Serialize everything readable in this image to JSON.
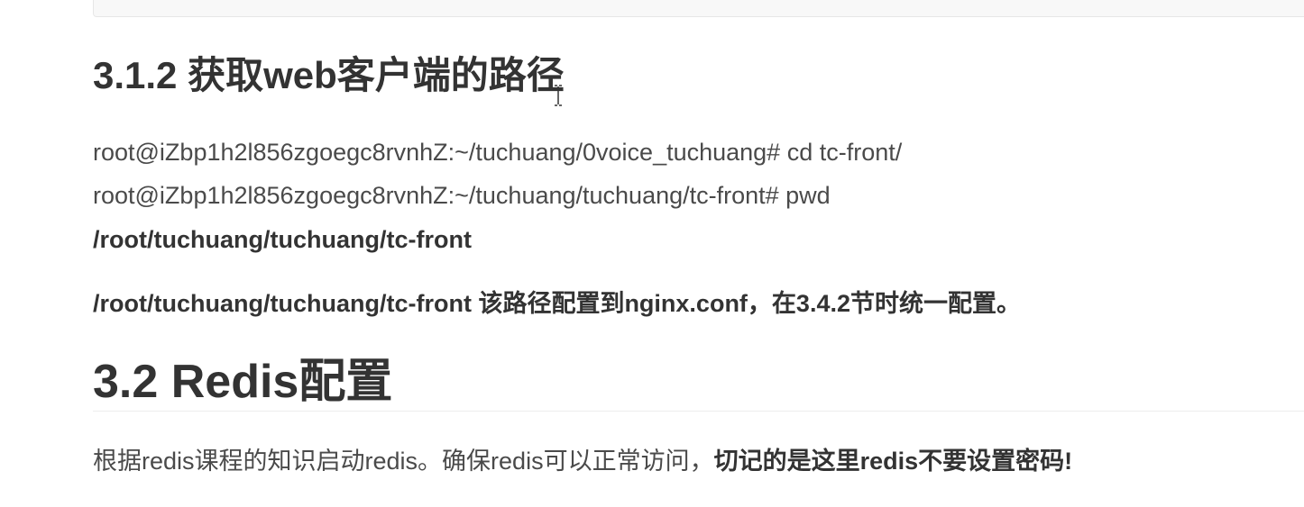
{
  "section_3_1_2": {
    "heading": "3.1.2 获取web客户端的路径",
    "lines": [
      "root@iZbp1h2l856zgoegc8rvnhZ:~/tuchuang/0voice_tuchuang# cd tc-front/",
      "root@iZbp1h2l856zgoegc8rvnhZ:~/tuchuang/tuchuang/tc-front# pwd",
      "/root/tuchuang/tuchuang/tc-front"
    ],
    "note": "/root/tuchuang/tuchuang/tc-front 该路径配置到nginx.conf，在3.4.2节时统一配置。"
  },
  "section_3_2": {
    "heading": "3.2 Redis配置",
    "paragraph_normal": "根据redis课程的知识启动redis。确保redis可以正常访问，",
    "paragraph_bold": "切记的是这里redis不要设置密码!"
  }
}
